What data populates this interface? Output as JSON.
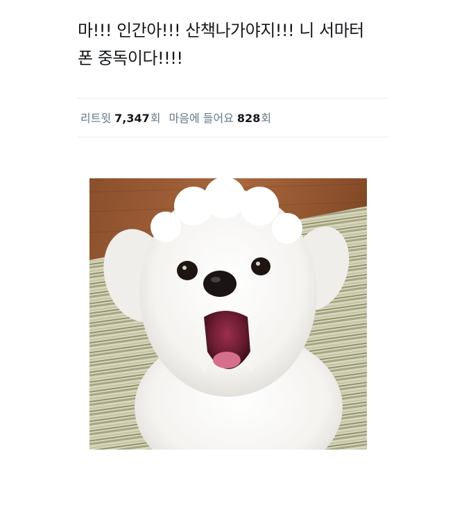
{
  "tweet": {
    "text": "마!!! 인간아!!! 산책나가야지!!! 니 서마터\n폰 중독이다!!!!"
  },
  "stats": {
    "retweets_label": "리트윗",
    "retweets_count": "7,347",
    "retweets_unit": "회",
    "likes_label": "마음에 들어요",
    "likes_count": "828",
    "likes_unit": "회"
  },
  "media": {
    "subject": "small white fluffy dog barking with open mouth on a striped rug"
  },
  "colors": {
    "text": "#14171a",
    "secondary": "#657786",
    "divider": "#e6ecf0"
  }
}
